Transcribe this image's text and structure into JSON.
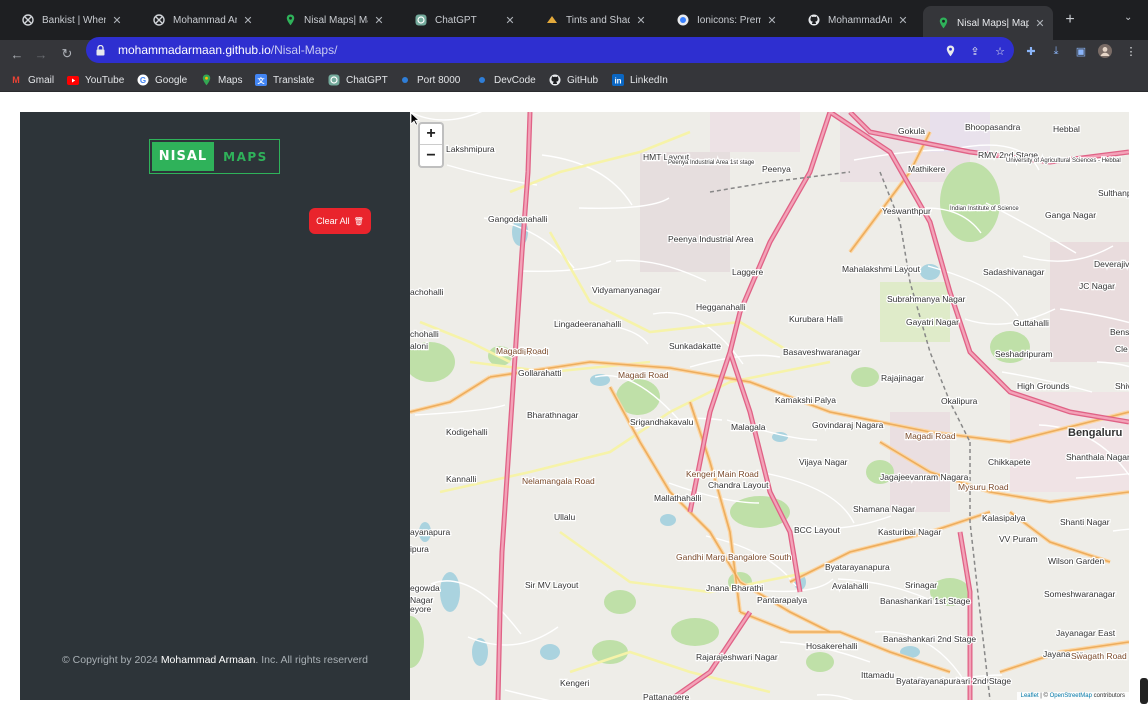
{
  "browser": {
    "tabs": [
      {
        "title": "Bankist | When Bankin",
        "icon": "bankist-icon",
        "active": false
      },
      {
        "title": "Mohammad Armaan",
        "icon": "bankist-icon",
        "active": false
      },
      {
        "title": "Nisal Maps| Maps",
        "icon": "map-pin-icon",
        "active": false
      },
      {
        "title": "ChatGPT",
        "icon": "chatgpt-icon",
        "active": false
      },
      {
        "title": "Tints and Shades",
        "icon": "palette-icon",
        "active": false
      },
      {
        "title": "Ionicons: Premium",
        "icon": "ionicons-icon",
        "active": false
      },
      {
        "title": "MohammadArmaan",
        "icon": "github-icon",
        "active": false
      },
      {
        "title": "Nisal Maps| Maps",
        "icon": "map-pin-icon",
        "active": true
      }
    ],
    "url_host": "mohammadarmaan.github.io",
    "url_path": "/Nisal-Maps/",
    "bookmarks": [
      {
        "label": "Gmail",
        "icon": "gmail-icon"
      },
      {
        "label": "YouTube",
        "icon": "youtube-icon"
      },
      {
        "label": "Google",
        "icon": "google-icon"
      },
      {
        "label": "Maps",
        "icon": "maps-icon"
      },
      {
        "label": "Translate",
        "icon": "translate-icon"
      },
      {
        "label": "ChatGPT",
        "icon": "chatgpt-icon"
      },
      {
        "label": "Port 8000",
        "icon": "globe-icon"
      },
      {
        "label": "DevCode",
        "icon": "globe-icon"
      },
      {
        "label": "GitHub",
        "icon": "github-icon"
      },
      {
        "label": "LinkedIn",
        "icon": "linkedin-icon"
      }
    ]
  },
  "sidebar": {
    "logo_left": "NISAL",
    "logo_right": "MAPS",
    "clear_button": "Clear All",
    "copyright_prefix": "© Copyright by 2024 ",
    "copyright_author": "Mohammad Armaan",
    "copyright_suffix": ". Inc. All rights reserverd"
  },
  "map": {
    "zoom_in": "+",
    "zoom_out": "−",
    "attribution_leaflet": "Leaflet",
    "attribution_sep": " | © ",
    "attribution_osm": "OpenStreetMap",
    "attribution_suffix": " contributors",
    "labels": [
      "Lakshmipura",
      "HMT Layout",
      "Peenya Industrial Area 1st stage",
      "Peenya",
      "Gokula",
      "Bhoopasandra",
      "Hebbal",
      "RMV 2nd Stage",
      "Mathikere",
      "University of Agricultural Sciences - Hebbal",
      "Sulthanpal",
      "Gangodanahalli",
      "Yeswanthpur",
      "Indian Institute of Science",
      "Ganga Nagar",
      "Peenya Industrial Area",
      "Laggere",
      "Mahalakshmi Layout",
      "Sadashivanagar",
      "Deverajiva",
      "achohalli",
      "Vidyamanyanagar",
      "JC Nagar",
      "Hegganahalli",
      "Subrahmanya Nagar",
      "Lingadeeranahalli",
      "Kurubara Halli",
      "Gayatri Nagar",
      "Guttahalli",
      "Benson To",
      "chohalli",
      "aloni",
      "Magadi Road",
      "Sunkadakatte",
      "Basaveshwaranagar",
      "Seshadripuram",
      "Cle",
      "Gollarahatti",
      "Rajajinagar",
      "High Grounds",
      "Shivaj",
      "Okalipura",
      "Bharathnagar",
      "Kamakshi Palya",
      "Srigandhakavalu",
      "Malagala",
      "Govindaraj Nagara",
      "Bengaluru",
      "Kodigehalli",
      "Vijaya Nagar",
      "Chikkapete",
      "Shanthala Nagar",
      "Kannalli",
      "Chandra Layout",
      "Jagajeevanram Nagara",
      "Mallathahalli",
      "Ullalu",
      "Shamana Nagar",
      "Kalasipalya",
      "Shanti Nagar",
      "BCC Layout",
      "Kasturibai Nagar",
      "VV Puram",
      "Wilson Garden",
      "Byatarayanapura",
      "Sir MV Layout",
      "Srinagar",
      "Jnana Bharathi",
      "Avalahalli",
      "Someshwaranagar",
      "Pantarapalya",
      "Banashankari 1st Stage",
      "Jayanagar East",
      "Banashankari 2nd Stage",
      "Hosakerehalli",
      "Jayanagar",
      "Rajarajeshwari Nagar",
      "Ittamadu",
      "Swagath Road",
      "Kengeri",
      "Banashankari 2nd Stage",
      "Pattanagere",
      "Byatarayanapura",
      "Gandhi Marg",
      "Bangalore South",
      "ayanapura",
      "ipura",
      "egowda",
      "Nagar",
      "eyore",
      "Magadi Road",
      "Magadi Road",
      "Kengeri Main Road",
      "Magadi Road",
      "Mysuru Road",
      "Nelamangala Road"
    ]
  }
}
